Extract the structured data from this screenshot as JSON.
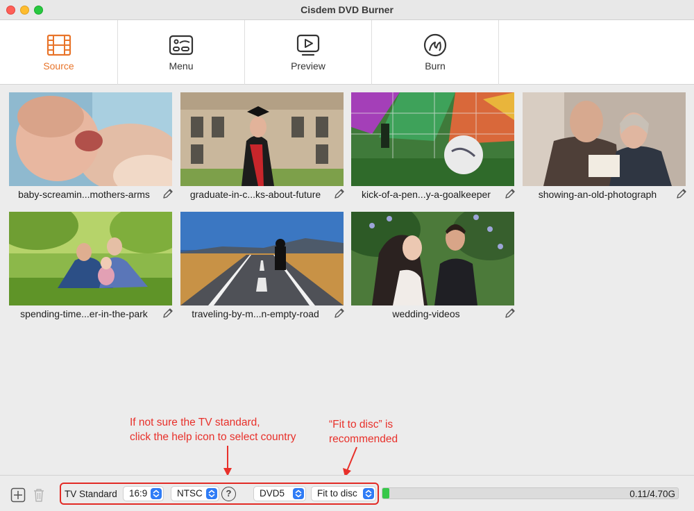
{
  "window": {
    "title": "Cisdem DVD Burner"
  },
  "tabs": [
    {
      "label": "Source",
      "icon": "film-strip-icon",
      "active": true
    },
    {
      "label": "Menu",
      "icon": "menu-template-icon",
      "active": false
    },
    {
      "label": "Preview",
      "icon": "play-screen-icon",
      "active": false
    },
    {
      "label": "Burn",
      "icon": "disc-burn-icon",
      "active": false
    }
  ],
  "videos": [
    {
      "name": "baby-screamin...mothers-arms"
    },
    {
      "name": "graduate-in-c...ks-about-future"
    },
    {
      "name": "kick-of-a-pen...y-a-goalkeeper"
    },
    {
      "name": "showing-an-old-photograph"
    },
    {
      "name": "spending-time...er-in-the-park"
    },
    {
      "name": "traveling-by-m...n-empty-road"
    },
    {
      "name": "wedding-videos"
    }
  ],
  "annotations": {
    "tv_line1": "If not sure the TV standard,",
    "tv_line2": "click the help icon to select country",
    "fit_line1": "“Fit to disc” is",
    "fit_line2": "recommended",
    "color": "#e8302a"
  },
  "bottom": {
    "tv_standard_label": "TV Standard",
    "aspect_ratio": "16:9",
    "tv_standard": "NTSC",
    "help_symbol": "?",
    "disc_type": "DVD5",
    "quality": "Fit to disc",
    "usage_text": "0.11/4.70G",
    "usage_fraction": 0.0234
  },
  "colors": {
    "accent": "#e8742a",
    "progress": "#37c84a",
    "stepper": "#2f7cf6",
    "highlight_box": "#e22a24"
  }
}
